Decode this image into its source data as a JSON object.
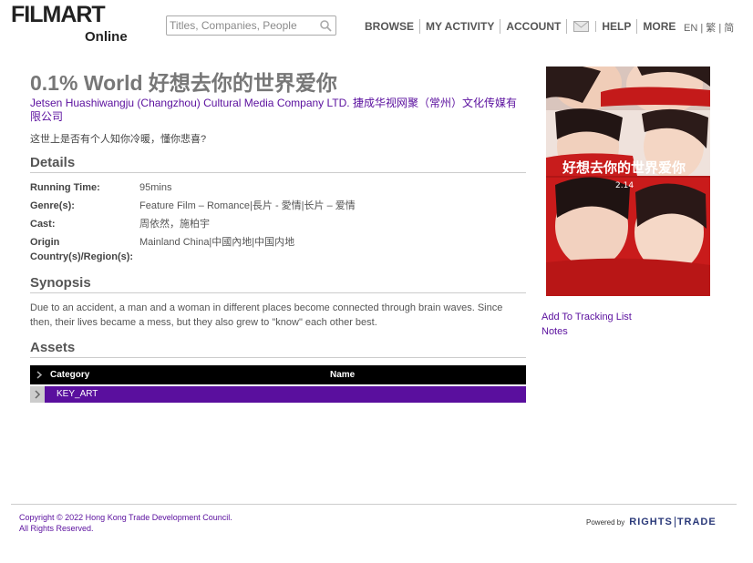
{
  "header": {
    "logo_main": "FILMART",
    "logo_sub": "Online",
    "search_placeholder": "Titles, Companies, People",
    "nav": [
      "BROWSE",
      "MY ACTIVITY",
      "ACCOUNT",
      "HELP",
      "MORE"
    ],
    "mail_icon": "envelope-icon",
    "lang": [
      "EN",
      "繁",
      "简"
    ]
  },
  "main": {
    "title": "0.1% World 好想去你的世界爱你",
    "company": "Jetsen Huashiwangju (Changzhou) Cultural Media Company LTD. 捷成华视网聚（常州）文化传媒有限公司",
    "tagline": "这世上是否有个人知你冷暖，懂你悲喜?",
    "details_heading": "Details",
    "details": [
      {
        "label": "Running Time:",
        "value": "95mins"
      },
      {
        "label": "Genre(s):",
        "value": "Feature Film – Romance|長片 - 愛情|长片 – 爱情"
      },
      {
        "label": "Cast:",
        "value": "周依然，施柏宇"
      },
      {
        "label": "Origin Country(s)/Region(s):",
        "value": "Mainland China|中國內地|中国内地"
      }
    ],
    "synopsis_heading": "Synopsis",
    "synopsis": "Due to an accident, a man and a woman in different places become connected through brain waves. Since then, their lives became a mess, but they also grew to \"know\" each other best.",
    "assets_heading": "Assets",
    "assets_table": {
      "columns": [
        "Category",
        "Name"
      ],
      "rows": [
        {
          "category": "KEY_ART",
          "name": ""
        }
      ]
    }
  },
  "sidebar": {
    "poster_icon": "movie-poster-image",
    "poster_text": "好想去你的世界爱你",
    "poster_date": "2.14",
    "links": [
      "Add To Tracking List",
      "Notes"
    ]
  },
  "footer": {
    "copyright_line1": "Copyright © 2022 Hong Kong Trade Development Council.",
    "copyright_line2": "All Rights Reserved.",
    "powered_by": "Powered by",
    "brand_left": "RIGHTS",
    "brand_right": "TRADE"
  },
  "colors": {
    "accent": "#5a0f9e",
    "table_header": "#000000",
    "title_grey": "#777777",
    "poster_red": "#c91b1b"
  }
}
